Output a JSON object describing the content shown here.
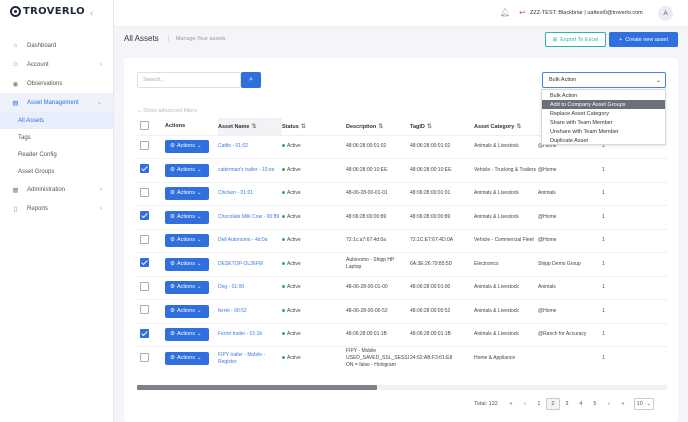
{
  "brand": {
    "name": "TROVERLO"
  },
  "sidebar": {
    "items": [
      {
        "label": "Dashboard",
        "icon": "home-icon",
        "glyph": "⌂"
      },
      {
        "label": "Account",
        "icon": "user-icon",
        "glyph": "☺"
      },
      {
        "label": "Observations",
        "icon": "eye-icon",
        "glyph": "◉"
      },
      {
        "label": "Asset Management",
        "icon": "briefcase-icon",
        "glyph": "▤"
      },
      {
        "label": "Administration",
        "icon": "building-icon",
        "glyph": "▦"
      },
      {
        "label": "Reports",
        "icon": "document-icon",
        "glyph": "▯"
      }
    ],
    "subitems": [
      "All Assets",
      "Tags",
      "Reader Config",
      "Asset Groups"
    ]
  },
  "header": {
    "user": "ZZZ-TEST: Blackbriar | uattest0@troverlo.com",
    "avatar": "A"
  },
  "page": {
    "title": "All Assets",
    "crumb": "Manage Your assets"
  },
  "toolbar": {
    "export_label": "Export To Excel",
    "create_label": "Create new asset"
  },
  "search": {
    "placeholder": "Search..."
  },
  "bulk": {
    "selected": "Bulk Action",
    "options": [
      "Bulk Action",
      "Add to Company Asset Groups",
      "Replace Asset Category",
      "Share with Team Member",
      "Unshare with Team Member",
      "Duplicate Asset"
    ]
  },
  "advanced": "Show advanced filters",
  "table": {
    "headers": [
      "Actions",
      "Asset Name",
      "Status",
      "Description",
      "TagID",
      "Asset Category",
      "",
      ""
    ],
    "action_label": "Actions",
    "rows": [
      {
        "checked": false,
        "name": "Cattle - 01:02",
        "status": "Active",
        "desc": "48:06:28:00:01:02",
        "tag": "48:06:28:00:01:02",
        "cat": "Animals & Livestock",
        "loc": "@Home",
        "n": "1"
      },
      {
        "checked": true,
        "name": "catterman's trailer - 10:ee",
        "status": "Active",
        "desc": "48:06:28:00:10:EE",
        "tag": "48:06:28:00:10:EE",
        "cat": "Vehicle - Trucking & Trailers",
        "loc": "@Home",
        "n": "1"
      },
      {
        "checked": false,
        "name": "Chicken - 01:01",
        "status": "Active",
        "desc": "48-06-28-00-01-01",
        "tag": "48:06:28:00:01:01",
        "cat": "Animals & Livestock",
        "loc": "Animals",
        "n": "1"
      },
      {
        "checked": true,
        "name": "Chocolate Milk Cow - 00:89",
        "status": "Active",
        "desc": "48:06:28:00:00:89",
        "tag": "48:06:28:00:00:89",
        "cat": "Animals & Livestock",
        "loc": "@Home",
        "n": "1"
      },
      {
        "checked": false,
        "name": "Dell Autonomo - 4d:0a",
        "status": "Active",
        "desc": "72:1c:a7:67:4d:0a",
        "tag": "72:1C:E7:67:4D:0A",
        "cat": "Vehicle - Commercial Fleet",
        "loc": "@Home",
        "n": "1"
      },
      {
        "checked": true,
        "name": "DESKTOP-OL36FM",
        "status": "Active",
        "desc": "Autonomo - Shipp HP Laptop",
        "tag": "6A:3E:26:79:85:5D",
        "cat": "Electronics",
        "loc": "Shipp Demo Group",
        "n": "1"
      },
      {
        "checked": false,
        "name": "Dog - 01:00",
        "status": "Active",
        "desc": "48-06-28-00-01-00",
        "tag": "48:06:28:00:01:00",
        "cat": "Animals & Livestock",
        "loc": "Animals",
        "n": "1"
      },
      {
        "checked": false,
        "name": "ferret - 00:52",
        "status": "Active",
        "desc": "48-06-28-00-00-52",
        "tag": "48:06:28:00:00:52",
        "cat": "Animals & Livestock",
        "loc": "@Home",
        "n": "1"
      },
      {
        "checked": true,
        "name": "Ferret trailer - 01:1b",
        "status": "Active",
        "desc": "48:06:28:00:01:1B",
        "tag": "48:06:28:00:01:1B",
        "cat": "Animals & Livestock",
        "loc": "@Ranch for Accuracy",
        "n": "1"
      },
      {
        "checked": false,
        "name": "FIPY trailer - Mobile - Register",
        "status": "Active",
        "desc": "FIPY - Mobile USED_SAVED_SSL_SESSI ON = false - Hologram",
        "tag": "24:62:AB:F3:61:E8",
        "cat": "Home & Appliance",
        "loc": "",
        "n": "1"
      }
    ]
  },
  "pagination": {
    "total": "Total: 122",
    "first": "«",
    "prev": "‹",
    "pages": [
      "1",
      "2",
      "3",
      "4",
      "5"
    ],
    "next": "›",
    "last": "»",
    "current": "2",
    "per_page": "10"
  },
  "colors": {
    "accent": "#2f6fde",
    "export": "#2ab6a8",
    "status": "#2fae5c"
  }
}
